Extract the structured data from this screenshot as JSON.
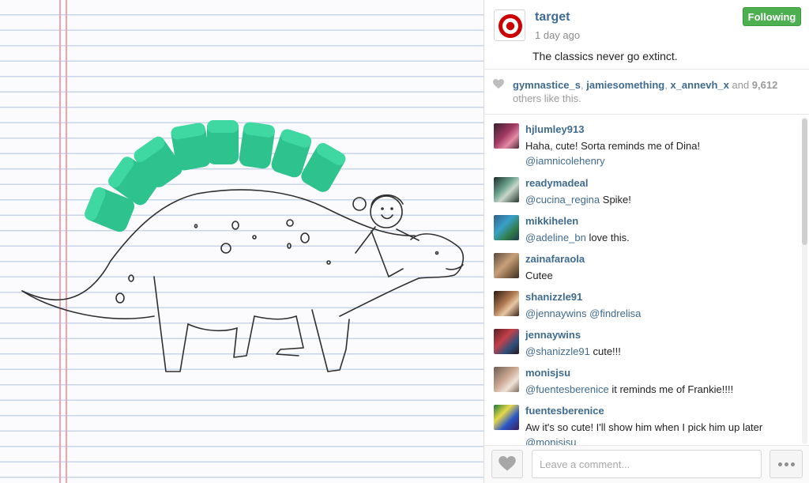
{
  "post": {
    "username": "target",
    "time_ago": "1 day ago",
    "follow_label": "Following",
    "caption": "The classics never go extinct.",
    "brand_color": "#cc0000"
  },
  "likes": {
    "users": [
      "gymnastice_s",
      "jamiesomething",
      "x_annevh_x"
    ],
    "sep1": ", ",
    "sep2": ", ",
    "and_word": " and ",
    "count": "9,612",
    "tail": "others like this."
  },
  "comments": [
    {
      "user": "hjlumley913",
      "text": "Haha, cute! Sorta reminds me of Dina!",
      "mention_after": "@iamnicolehenry"
    },
    {
      "user": "readymadeal",
      "mention": "@cucina_regina",
      "text": " Spike!"
    },
    {
      "user": "mikkihelen",
      "mention": "@adeline_bn",
      "text": " love this."
    },
    {
      "user": "zainafaraola",
      "text": "Cutee"
    },
    {
      "user": "shanizzle91",
      "mention": "@jennaywins @findrelisa",
      "text": ""
    },
    {
      "user": "jennaywins",
      "mention": "@shanizzle91",
      "text": " cute!!!"
    },
    {
      "user": "monisjsu",
      "mention": "@fuentesberenice",
      "text": " it reminds me of Frankie!!!!"
    },
    {
      "user": "fuentesberenice",
      "text": "Aw it's so cute! I'll show him when I pick him up later",
      "mention_after": "@monisjsu"
    }
  ],
  "footer": {
    "comment_placeholder": "Leave a comment..."
  },
  "icons": {
    "logo": "target-logo-icon",
    "heart": "heart-icon",
    "more": "more-options-icon"
  },
  "colors": {
    "username_link": "#3f6b91",
    "following_green": "#4caf50",
    "eraser_green": "#2fc590"
  }
}
